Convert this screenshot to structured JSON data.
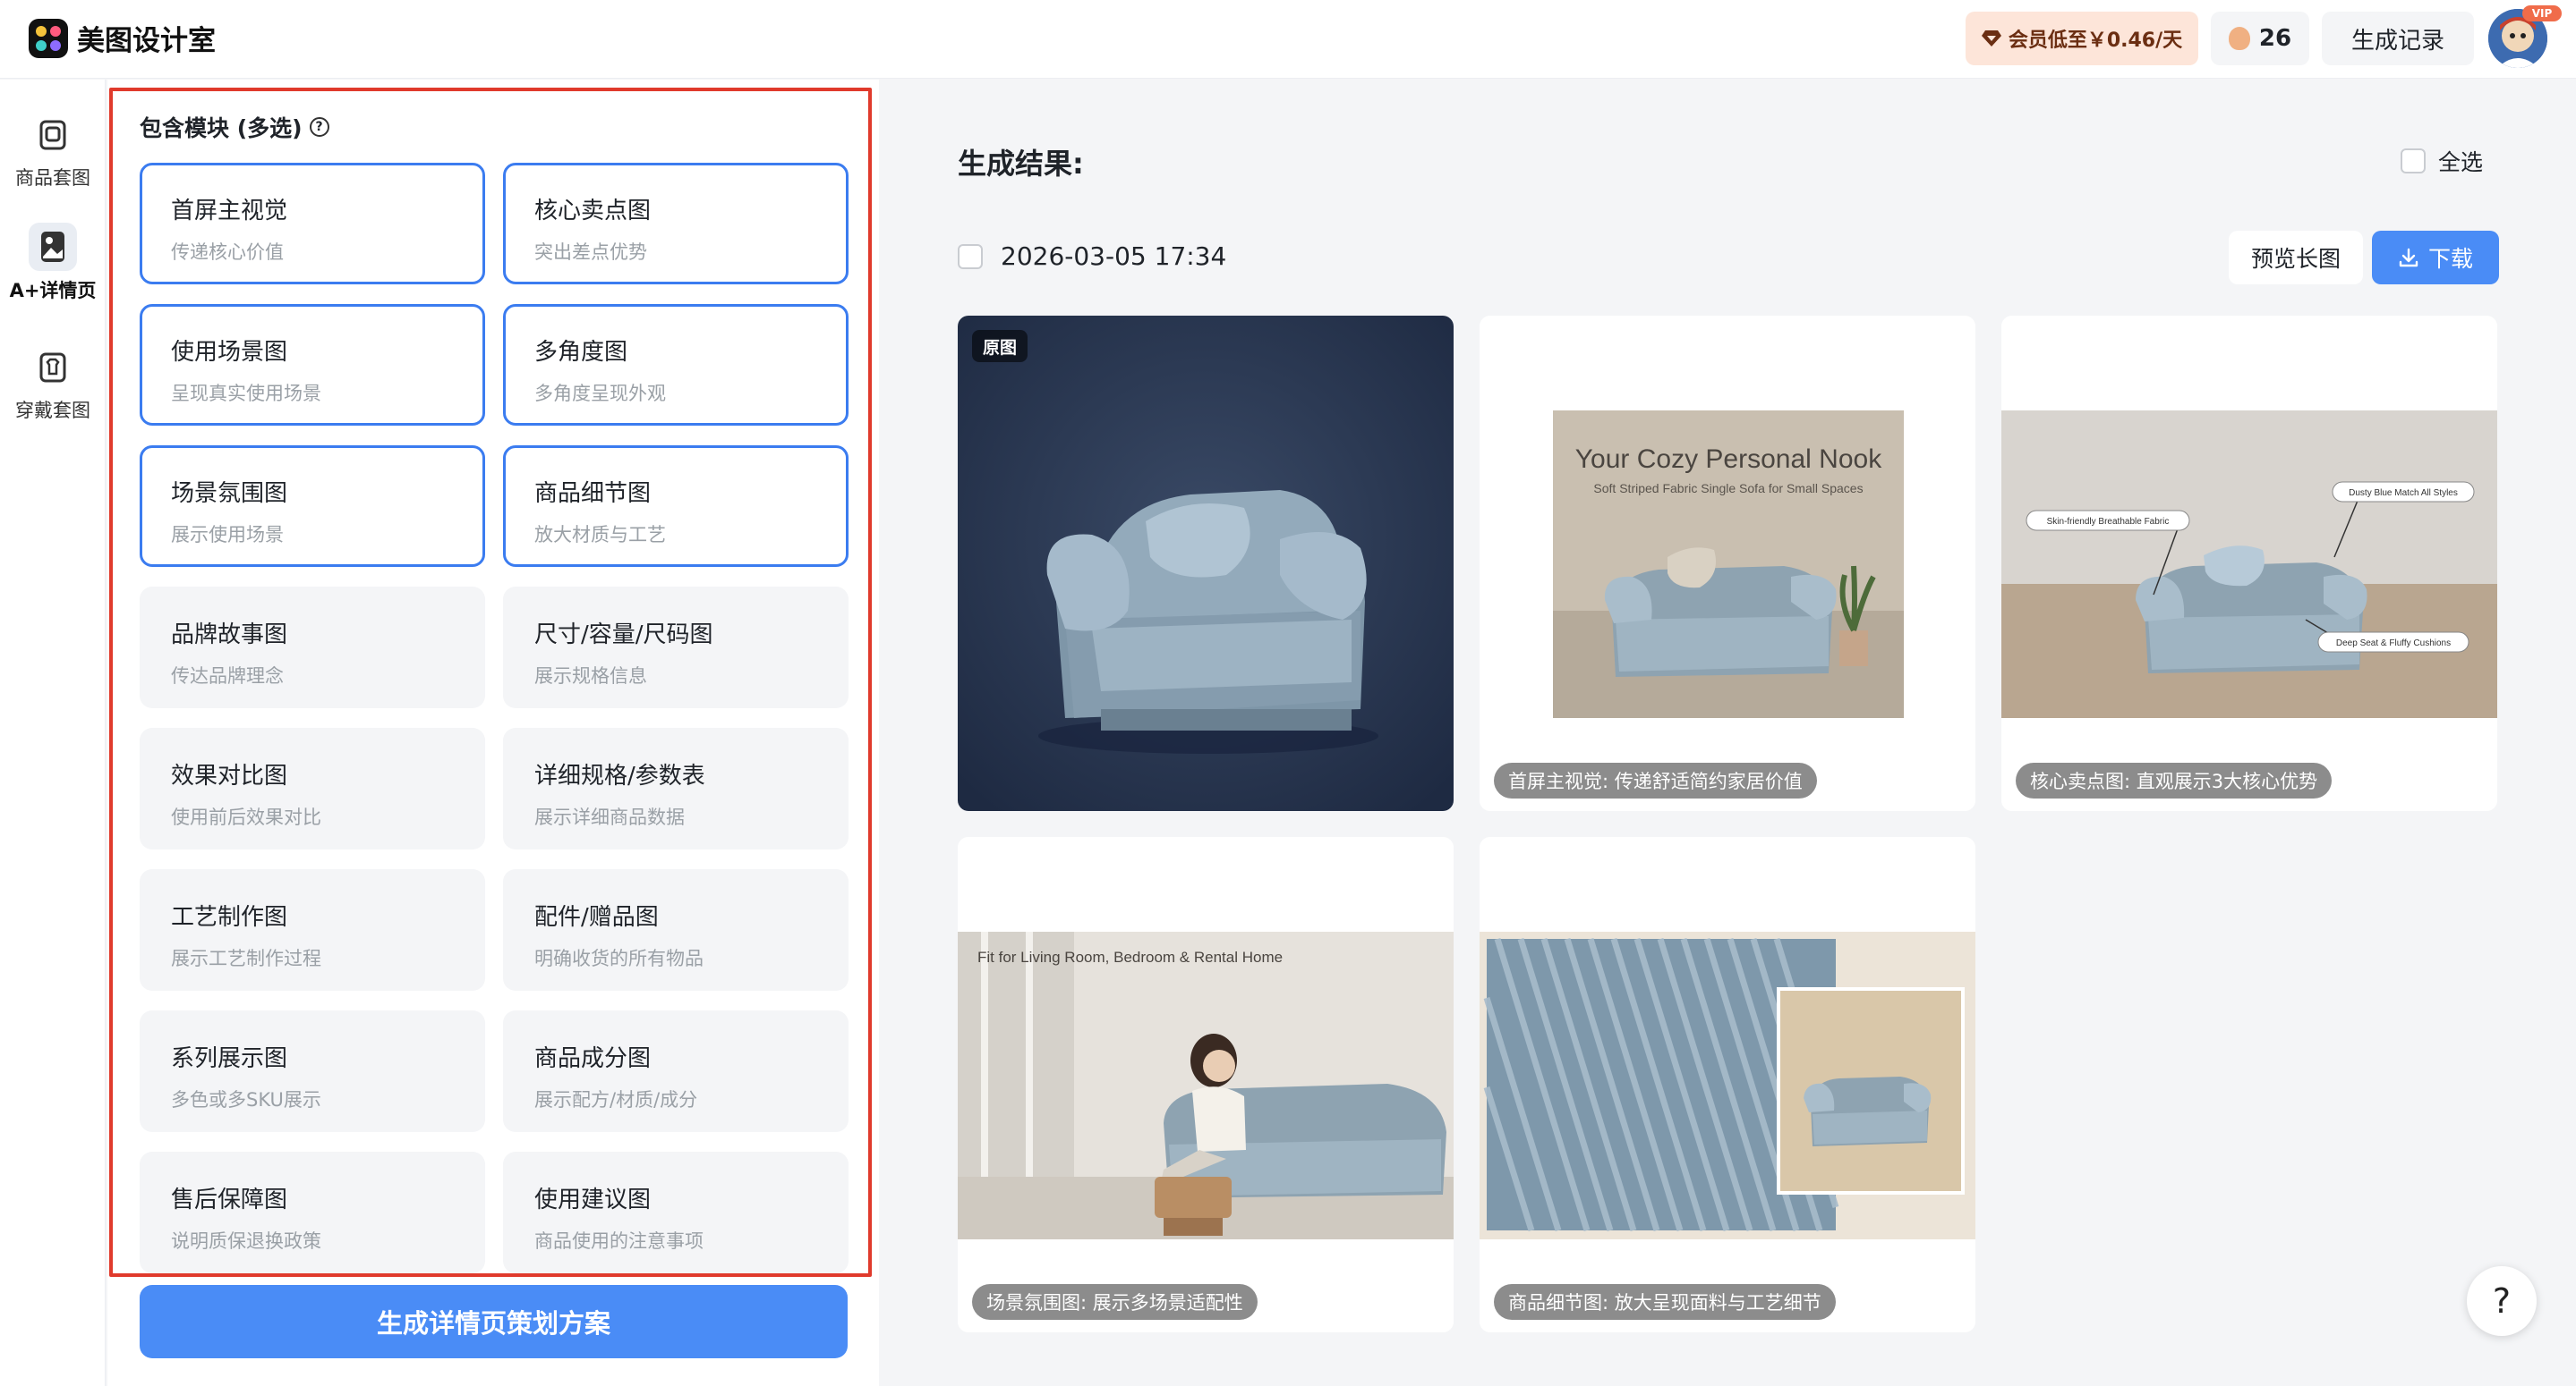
{
  "app": {
    "name": "美图设计室"
  },
  "header": {
    "vip_offer": "会员低至￥0.46/天",
    "credits": "26",
    "history_label": "生成记录",
    "vip_badge": "VIP"
  },
  "sidebar": {
    "items": [
      {
        "label": "商品套图",
        "icon": "product-set-icon",
        "active": false
      },
      {
        "label": "A+详情页",
        "icon": "detail-page-icon",
        "active": true
      },
      {
        "label": "穿戴套图",
        "icon": "wearable-set-icon",
        "active": false
      }
    ]
  },
  "modules": {
    "title": "包含模块 (多选)",
    "help_glyph": "?",
    "items": [
      {
        "title": "首屏主视觉",
        "desc": "传递核心价值",
        "selected": true
      },
      {
        "title": "核心卖点图",
        "desc": "突出差点优势",
        "selected": true
      },
      {
        "title": "使用场景图",
        "desc": "呈现真实使用场景",
        "selected": true
      },
      {
        "title": "多角度图",
        "desc": "多角度呈现外观",
        "selected": true
      },
      {
        "title": "场景氛围图",
        "desc": "展示使用场景",
        "selected": true
      },
      {
        "title": "商品细节图",
        "desc": "放大材质与工艺",
        "selected": true
      },
      {
        "title": "品牌故事图",
        "desc": "传达品牌理念",
        "selected": false
      },
      {
        "title": "尺寸/容量/尺码图",
        "desc": "展示规格信息",
        "selected": false
      },
      {
        "title": "效果对比图",
        "desc": "使用前后效果对比",
        "selected": false
      },
      {
        "title": "详细规格/参数表",
        "desc": "展示详细商品数据",
        "selected": false
      },
      {
        "title": "工艺制作图",
        "desc": "展示工艺制作过程",
        "selected": false
      },
      {
        "title": "配件/赠品图",
        "desc": "明确收货的所有物品",
        "selected": false
      },
      {
        "title": "系列展示图",
        "desc": "多色或多SKU展示",
        "selected": false
      },
      {
        "title": "商品成分图",
        "desc": "展示配方/材质/成分",
        "selected": false
      },
      {
        "title": "售后保障图",
        "desc": "说明质保退换政策",
        "selected": false
      },
      {
        "title": "使用建议图",
        "desc": "商品使用的注意事项",
        "selected": false
      }
    ],
    "generate_button": "生成详情页策划方案"
  },
  "results": {
    "title": "生成结果:",
    "select_all": "全选",
    "timestamp": "2026-03-05 17:34",
    "preview_button": "预览长图",
    "download_button": "下载",
    "images": [
      {
        "tag": "原图",
        "caption": ""
      },
      {
        "tag": "",
        "caption": "首屏主视觉: 传递舒适简约家居价值",
        "headline": "Your Cozy Personal Nook",
        "subline": "Soft Striped Fabric Single Sofa for Small Spaces"
      },
      {
        "tag": "",
        "caption": "核心卖点图: 直观展示3大核心优势",
        "callouts": [
          "Skin-friendly Breathable Fabric",
          "Dusty Blue Match All Styles",
          "Deep Seat & Fluffy Cushions"
        ]
      },
      {
        "tag": "",
        "caption": "场景氛围图: 展示多场景适配性",
        "headline": "Fit for Living Room, Bedroom & Rental Home"
      },
      {
        "tag": "",
        "caption": "商品细节图: 放大呈现面料与工艺细节"
      }
    ]
  },
  "help_fab": "?",
  "colors": {
    "accent": "#4a8cf6",
    "frame": "#e03a2c",
    "sofa": "#8fa8b8"
  }
}
